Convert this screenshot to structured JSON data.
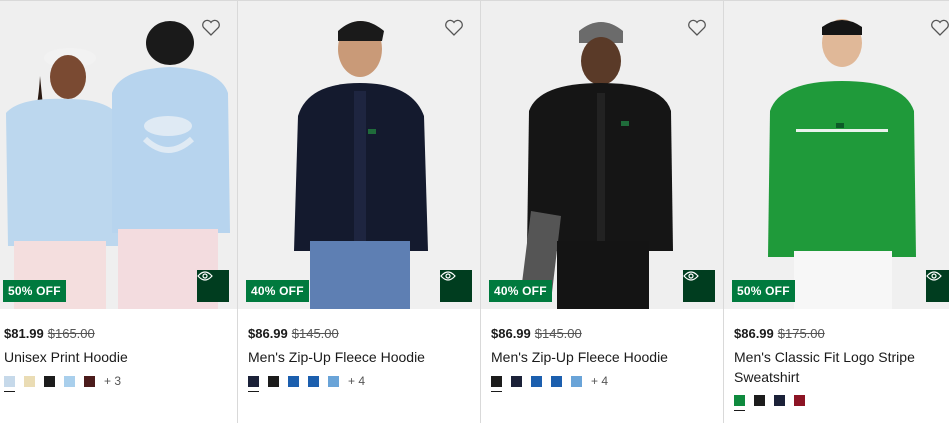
{
  "products": [
    {
      "discount": "50% OFF",
      "price": "$81.99",
      "original_price": "$165.00",
      "name": "Unisex Print Hoodie",
      "colors": [
        "#c6d9ea",
        "#eadcb4",
        "#1c1c1c",
        "#a9cfec",
        "#4b1b1b"
      ],
      "more": "+ 3"
    },
    {
      "discount": "40% OFF",
      "price": "$86.99",
      "original_price": "$145.00",
      "name": "Men's Zip-Up Fleece Hoodie",
      "colors": [
        "#1b2138",
        "#1c1c1c",
        "#1c5fae",
        "#1c5fae",
        "#6aa4d8"
      ],
      "more": "+ 4"
    },
    {
      "discount": "40% OFF",
      "price": "$86.99",
      "original_price": "$145.00",
      "name": "Men's Zip-Up Fleece Hoodie",
      "colors": [
        "#1c1c1c",
        "#1b2138",
        "#1c5fae",
        "#1c5fae",
        "#6aa4d8"
      ],
      "more": "+ 4"
    },
    {
      "discount": "50% OFF",
      "price": "$86.99",
      "original_price": "$175.00",
      "name": "Men's Classic Fit Logo Stripe Sweatshirt",
      "colors": [
        "#0f8a3e",
        "#1c1c1c",
        "#1b2138",
        "#8c1424"
      ],
      "more": ""
    }
  ]
}
